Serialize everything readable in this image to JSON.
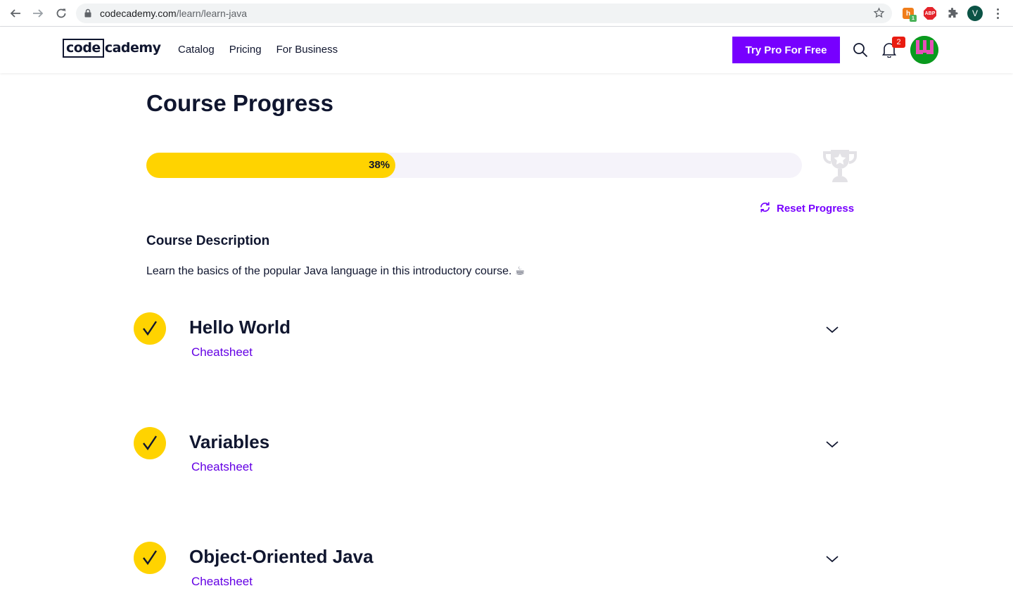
{
  "browser": {
    "url_host": "codecademy.com",
    "url_path": "/learn/learn-java",
    "extensions": {
      "honey_badge": "1",
      "abp_label": "ABP"
    },
    "profile_initial": "V"
  },
  "header": {
    "logo_boxed": "code",
    "logo_rest": "cademy",
    "nav": [
      "Catalog",
      "Pricing",
      "For Business"
    ],
    "cta_label": "Try Pro For Free",
    "notification_count": "2"
  },
  "page": {
    "title": "Course Progress",
    "progress_percent": 38,
    "progress_label": "38%",
    "reset_label": "Reset Progress",
    "description_heading": "Course Description",
    "description_text": "Learn the basics of the popular Java language in this introductory course. ☕"
  },
  "modules": [
    {
      "title": "Hello World",
      "link": "Cheatsheet",
      "completed": true
    },
    {
      "title": "Variables",
      "link": "Cheatsheet",
      "completed": true
    },
    {
      "title": "Object-Oriented Java",
      "link": "Cheatsheet",
      "completed": true
    }
  ],
  "colors": {
    "accent": "#7700ff",
    "progress": "#ffd300",
    "text": "#10162f"
  }
}
